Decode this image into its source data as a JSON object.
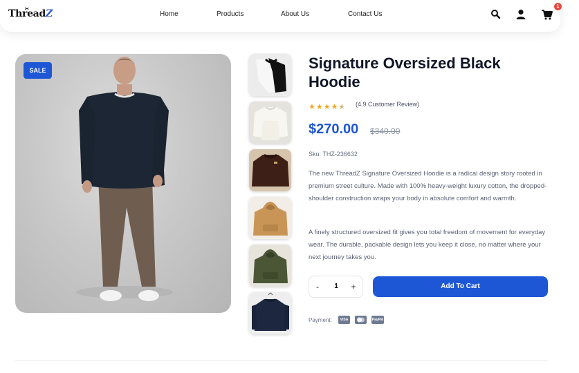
{
  "brand": {
    "logo_text_main": "Thread",
    "logo_text_accent": "Z"
  },
  "nav": {
    "links": [
      {
        "label": "Home"
      },
      {
        "label": "Products"
      },
      {
        "label": "About Us"
      },
      {
        "label": "Contact Us"
      }
    ],
    "icons": [
      "search-icon",
      "user-icon",
      "cart-icon"
    ],
    "cart_count": "1"
  },
  "gallery": {
    "sale_label": "SALE",
    "thumbnails": [
      {
        "name": "black-white-sweater"
      },
      {
        "name": "cream-sweater"
      },
      {
        "name": "brown-sweater"
      },
      {
        "name": "tan-hoodie"
      },
      {
        "name": "olive-hoodie"
      },
      {
        "name": "navy-sweater"
      }
    ]
  },
  "product": {
    "title": "Signature Oversized Black Hoodie",
    "rating": 4.5,
    "review_text": "(4.9 Customer Review)",
    "price": "$270.00",
    "old_price": "$340.00",
    "sku": "Sku: THZ-236632",
    "description_1": "The new ThreadZ Signature Oversized Hoodie is a radical design story rooted in premium street culture. Made with 100% heavy-weight luxury cotton, the dropped-shoulder construction wraps your body in absolute comfort and warmth.",
    "description_2": "A finely structured oversized fit gives you total freedom of movement for everyday wear. The durable, packable design lets you keep it close, no matter where your next journey takes you."
  },
  "purchase": {
    "minus": "-",
    "plus": "+",
    "quantity": "1",
    "add_to_cart": "Add To Cart",
    "payment_label": "Payment:",
    "payment_methods": [
      {
        "name": "VISA"
      },
      {
        "name": "mastercard"
      },
      {
        "name": "PayPal"
      }
    ]
  },
  "colors": {
    "accent": "#1e57d6",
    "badge": "#e74a3b",
    "star": "#f2a51a"
  }
}
